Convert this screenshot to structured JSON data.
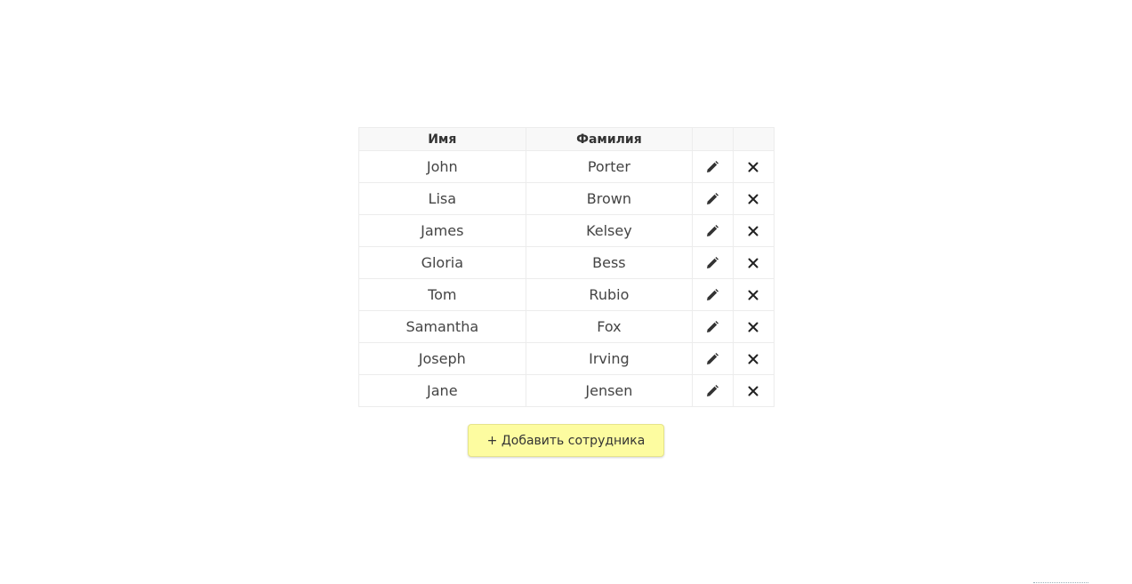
{
  "table": {
    "headers": {
      "first_name": "Имя",
      "last_name": "Фамилия"
    },
    "rows": [
      {
        "first_name": "John",
        "last_name": "Porter"
      },
      {
        "first_name": "Lisa",
        "last_name": "Brown"
      },
      {
        "first_name": "James",
        "last_name": "Kelsey"
      },
      {
        "first_name": "Gloria",
        "last_name": "Bess"
      },
      {
        "first_name": "Tom",
        "last_name": "Rubio"
      },
      {
        "first_name": "Samantha",
        "last_name": "Fox"
      },
      {
        "first_name": "Joseph",
        "last_name": "Irving"
      },
      {
        "first_name": "Jane",
        "last_name": "Jensen"
      }
    ],
    "row_actions": {
      "edit_icon": "pencil-icon",
      "delete_icon": "close-icon"
    }
  },
  "add_button": {
    "label": "+ Добавить сотрудника",
    "background": "#fdfca0"
  },
  "colors": {
    "text": "#333333",
    "header_bg": "#f8f8f8",
    "border": "#ececec"
  }
}
